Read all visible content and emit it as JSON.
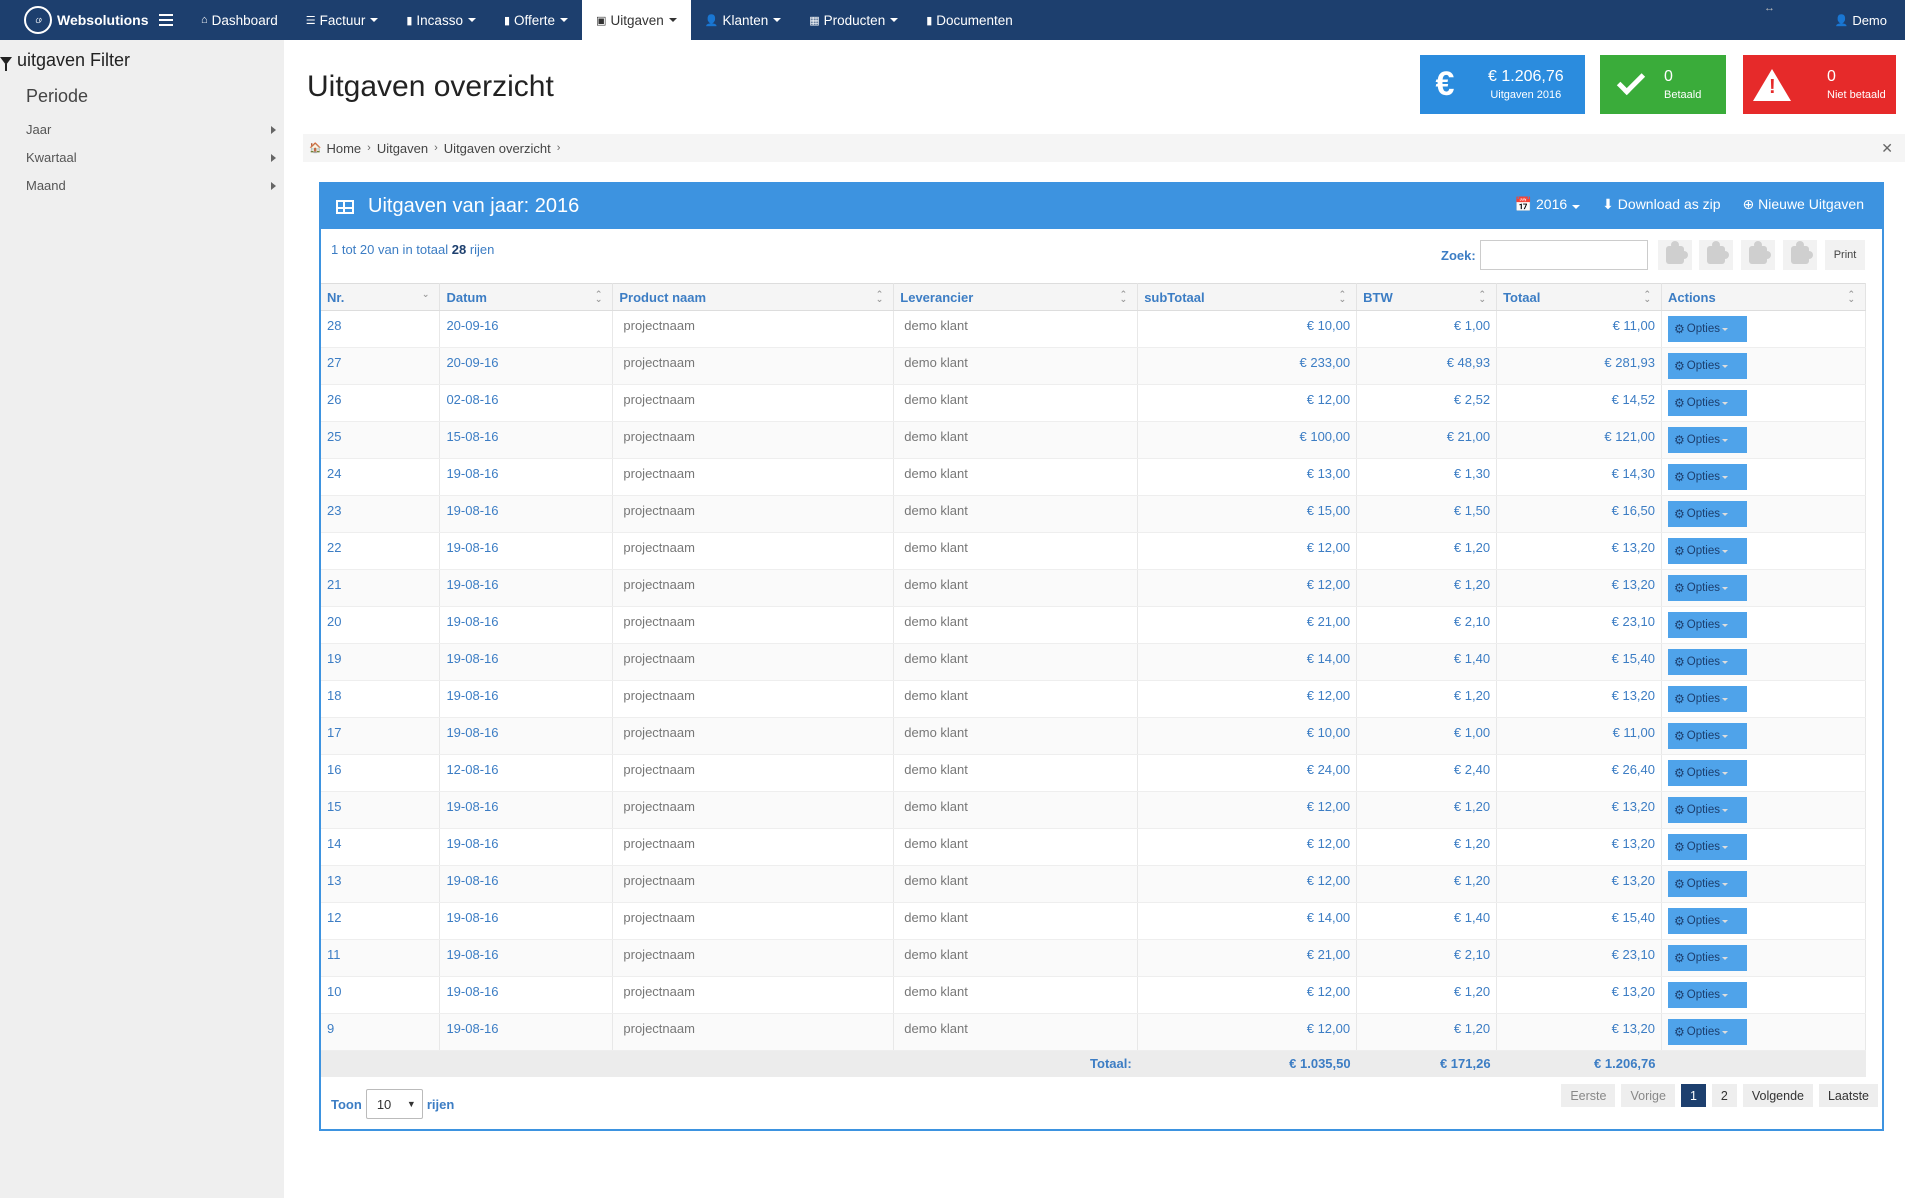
{
  "navbar": {
    "brand": "Websolutions",
    "items": [
      {
        "label": "Dashboard",
        "icon": "home-icon",
        "dropdown": false
      },
      {
        "label": "Factuur",
        "icon": "list-icon",
        "dropdown": true
      },
      {
        "label": "Incasso",
        "icon": "book-icon",
        "dropdown": true
      },
      {
        "label": "Offerte",
        "icon": "book-icon",
        "dropdown": true
      },
      {
        "label": "Uitgaven",
        "icon": "briefcase-icon",
        "dropdown": true,
        "active": true
      },
      {
        "label": "Klanten",
        "icon": "user-icon",
        "dropdown": true
      },
      {
        "label": "Producten",
        "icon": "table-icon",
        "dropdown": true
      },
      {
        "label": "Documenten",
        "icon": "book-icon",
        "dropdown": false
      }
    ],
    "user": "Demo"
  },
  "sidebar": {
    "title": "uitgaven Filter",
    "section": "Periode",
    "items": [
      "Jaar",
      "Kwartaal",
      "Maand"
    ]
  },
  "page": {
    "title": "Uitgaven overzicht"
  },
  "stats": {
    "spend": {
      "value": "€ 1.206,76",
      "label": "Uitgaven 2016",
      "color": "#2b8cde"
    },
    "paid": {
      "value": "0",
      "label": "Betaald",
      "color": "#3aac3a"
    },
    "unpaid": {
      "value": "0",
      "label": "Niet betaald",
      "color": "#e62a2a"
    }
  },
  "breadcrumb": [
    "Home",
    "Uitgaven",
    "Uitgaven overzicht"
  ],
  "panel": {
    "title": "Uitgaven van jaar: 2016",
    "year_button": "2016",
    "download_button": "Download as zip",
    "new_button": "Nieuwe Uitgaven",
    "info_prefix": "1 tot 20 van in totaal",
    "info_total": "28",
    "info_suffix": "rijen",
    "search_label": "Zoek:",
    "search_value": "",
    "print_label": "Print"
  },
  "table": {
    "columns": [
      "Nr.",
      "Datum",
      "Product naam",
      "Leverancier",
      "subTotaal",
      "BTW",
      "Totaal",
      "Actions"
    ],
    "action_label": "Opties",
    "rows": [
      [
        "28",
        "20-09-16",
        "projectnaam",
        "demo klant",
        "€ 10,00",
        "€ 1,00",
        "€ 11,00"
      ],
      [
        "27",
        "20-09-16",
        "projectnaam",
        "demo klant",
        "€ 233,00",
        "€ 48,93",
        "€ 281,93"
      ],
      [
        "26",
        "02-08-16",
        "projectnaam",
        "demo klant",
        "€ 12,00",
        "€ 2,52",
        "€ 14,52"
      ],
      [
        "25",
        "15-08-16",
        "projectnaam",
        "demo klant",
        "€ 100,00",
        "€ 21,00",
        "€ 121,00"
      ],
      [
        "24",
        "19-08-16",
        "projectnaam",
        "demo klant",
        "€ 13,00",
        "€ 1,30",
        "€ 14,30"
      ],
      [
        "23",
        "19-08-16",
        "projectnaam",
        "demo klant",
        "€ 15,00",
        "€ 1,50",
        "€ 16,50"
      ],
      [
        "22",
        "19-08-16",
        "projectnaam",
        "demo klant",
        "€ 12,00",
        "€ 1,20",
        "€ 13,20"
      ],
      [
        "21",
        "19-08-16",
        "projectnaam",
        "demo klant",
        "€ 12,00",
        "€ 1,20",
        "€ 13,20"
      ],
      [
        "20",
        "19-08-16",
        "projectnaam",
        "demo klant",
        "€ 21,00",
        "€ 2,10",
        "€ 23,10"
      ],
      [
        "19",
        "19-08-16",
        "projectnaam",
        "demo klant",
        "€ 14,00",
        "€ 1,40",
        "€ 15,40"
      ],
      [
        "18",
        "19-08-16",
        "projectnaam",
        "demo klant",
        "€ 12,00",
        "€ 1,20",
        "€ 13,20"
      ],
      [
        "17",
        "19-08-16",
        "projectnaam",
        "demo klant",
        "€ 10,00",
        "€ 1,00",
        "€ 11,00"
      ],
      [
        "16",
        "12-08-16",
        "projectnaam",
        "demo klant",
        "€ 24,00",
        "€ 2,40",
        "€ 26,40"
      ],
      [
        "15",
        "19-08-16",
        "projectnaam",
        "demo klant",
        "€ 12,00",
        "€ 1,20",
        "€ 13,20"
      ],
      [
        "14",
        "19-08-16",
        "projectnaam",
        "demo klant",
        "€ 12,00",
        "€ 1,20",
        "€ 13,20"
      ],
      [
        "13",
        "19-08-16",
        "projectnaam",
        "demo klant",
        "€ 12,00",
        "€ 1,20",
        "€ 13,20"
      ],
      [
        "12",
        "19-08-16",
        "projectnaam",
        "demo klant",
        "€ 14,00",
        "€ 1,40",
        "€ 15,40"
      ],
      [
        "11",
        "19-08-16",
        "projectnaam",
        "demo klant",
        "€ 21,00",
        "€ 2,10",
        "€ 23,10"
      ],
      [
        "10",
        "19-08-16",
        "projectnaam",
        "demo klant",
        "€ 12,00",
        "€ 1,20",
        "€ 13,20"
      ],
      [
        "9",
        "19-08-16",
        "projectnaam",
        "demo klant",
        "€ 12,00",
        "€ 1,20",
        "€ 13,20"
      ]
    ],
    "footer": {
      "label": "Totaal:",
      "subtotal": "€ 1.035,50",
      "btw": "€ 171,26",
      "total": "€ 1.206,76"
    }
  },
  "length_menu": {
    "prefix": "Toon",
    "value": "10",
    "suffix": "rijen"
  },
  "pagination": {
    "first": "Eerste",
    "prev": "Vorige",
    "pages": [
      "1",
      "2"
    ],
    "current": "1",
    "next": "Volgende",
    "last": "Laatste"
  }
}
